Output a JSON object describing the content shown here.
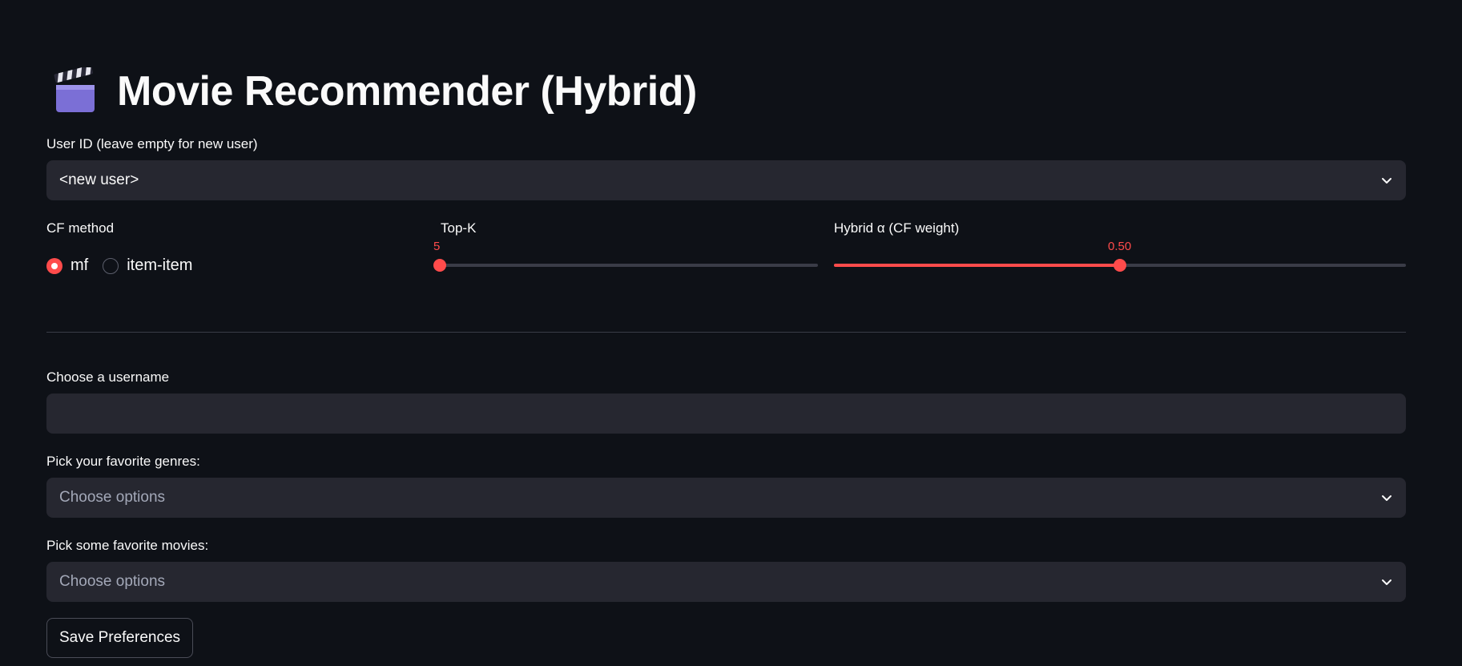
{
  "header": {
    "title": "Movie Recommender (Hybrid)",
    "icon": "clapper-board-icon"
  },
  "user_select": {
    "label": "User ID (leave empty for new user)",
    "value": "<new user>"
  },
  "cf_method": {
    "label": "CF method",
    "options": [
      "mf",
      "item-item"
    ],
    "selected": "mf"
  },
  "topk": {
    "label": "Top-K",
    "value": "5",
    "fraction": 0.0
  },
  "alpha": {
    "label": "Hybrid α (CF weight)",
    "value": "0.50",
    "fraction": 0.5
  },
  "username": {
    "label": "Choose a username",
    "value": ""
  },
  "genres": {
    "label": "Pick your favorite genres:",
    "placeholder": "Choose options"
  },
  "movies": {
    "label": "Pick some favorite movies:",
    "placeholder": "Choose options"
  },
  "save_button": {
    "label": "Save Preferences"
  },
  "colors": {
    "background": "#0e1117",
    "accent": "#ff4b4b",
    "field": "#262730"
  }
}
